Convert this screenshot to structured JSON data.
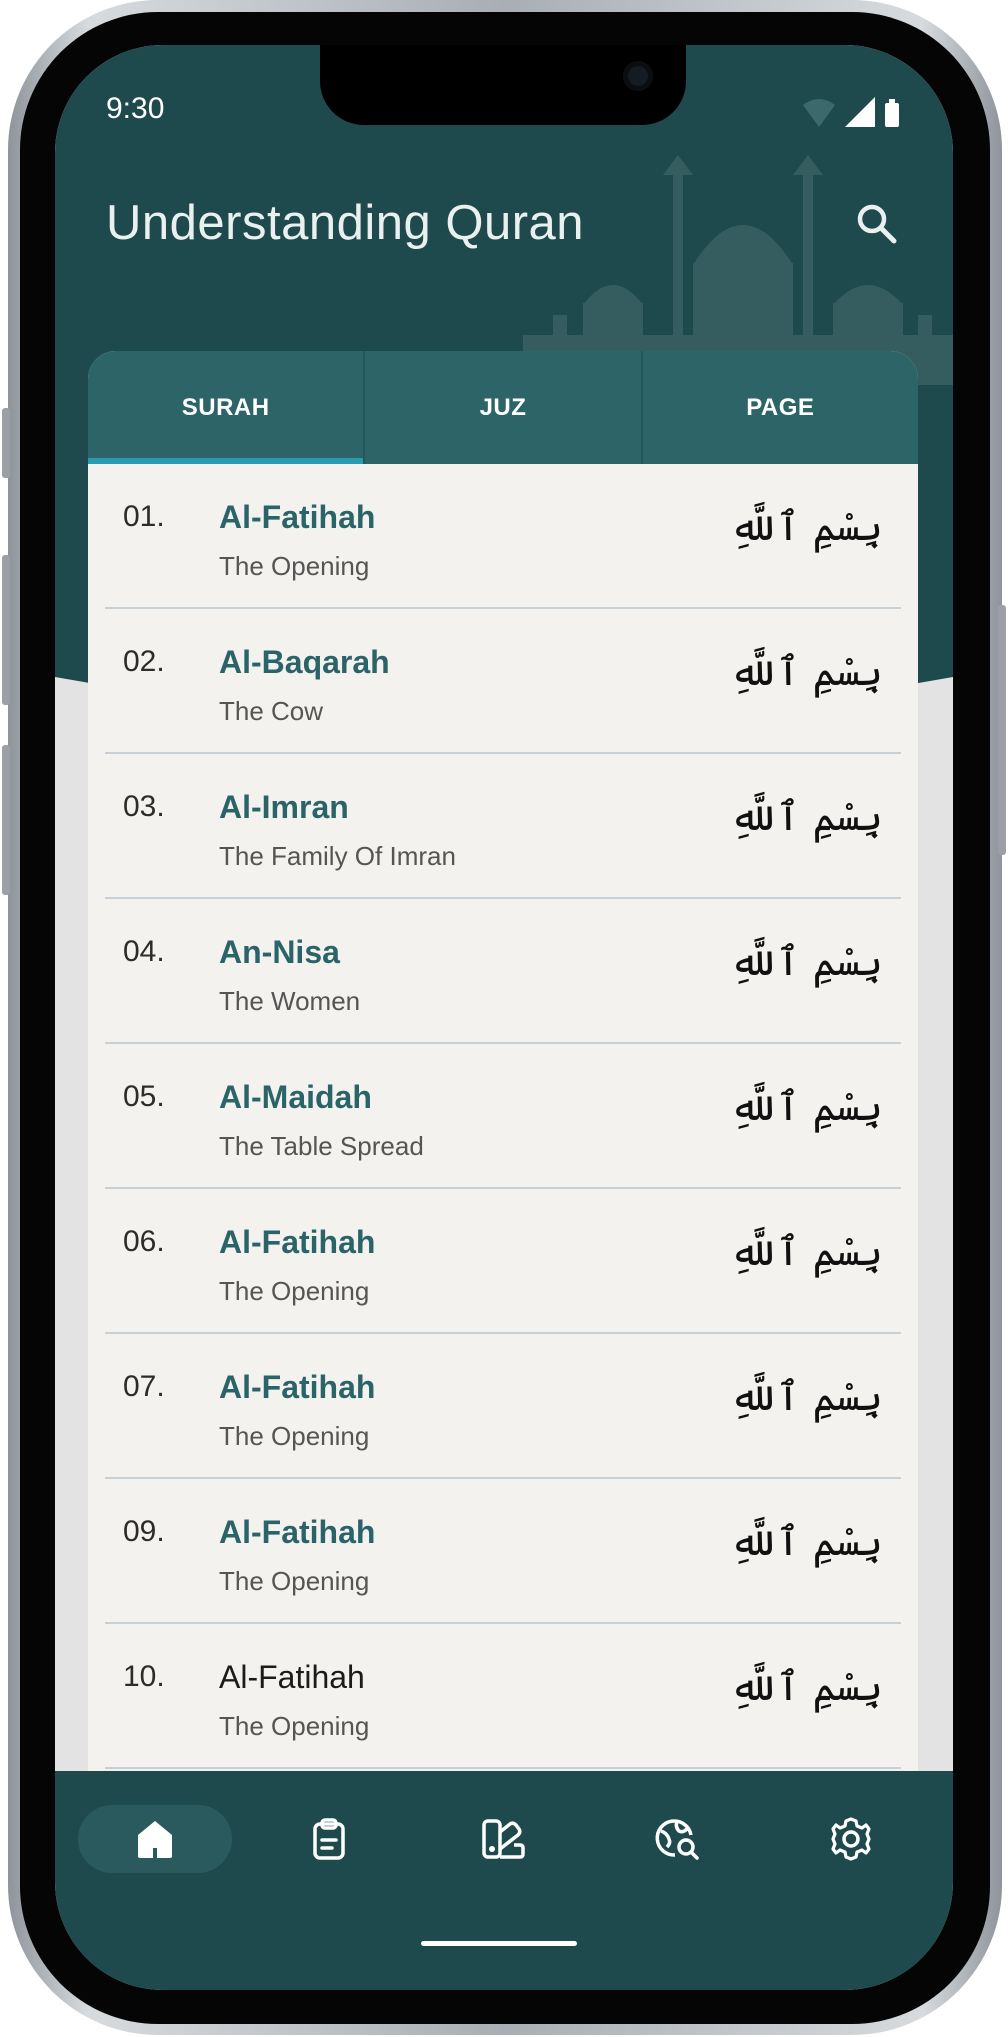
{
  "status_bar": {
    "time": "9:30"
  },
  "app": {
    "title": "Understanding Quran"
  },
  "tabs": [
    {
      "label": "SURAH",
      "active": true
    },
    {
      "label": "JUZ",
      "active": false
    },
    {
      "label": "PAGE",
      "active": false
    }
  ],
  "surahs": [
    {
      "number": "01.",
      "name": "Al-Fatihah",
      "meaning": "The Opening",
      "arabic": "بِسْمِ ٱللَّهِ"
    },
    {
      "number": "02.",
      "name": "Al-Baqarah",
      "meaning": "The Cow",
      "arabic": "بِسْمِ ٱللَّهِ"
    },
    {
      "number": "03.",
      "name": "Al-Imran",
      "meaning": "The Family Of Imran",
      "arabic": "بِسْمِ ٱللَّهِ"
    },
    {
      "number": "04.",
      "name": "An-Nisa",
      "meaning": "The Women",
      "arabic": "بِسْمِ ٱللَّهِ"
    },
    {
      "number": "05.",
      "name": "Al-Maidah",
      "meaning": "The Table Spread",
      "arabic": "بِسْمِ ٱللَّهِ"
    },
    {
      "number": "06.",
      "name": "Al-Fatihah",
      "meaning": "The Opening",
      "arabic": "بِسْمِ ٱللَّهِ"
    },
    {
      "number": "07.",
      "name": "Al-Fatihah",
      "meaning": "The Opening",
      "arabic": "بِسْمِ ٱللَّهِ"
    },
    {
      "number": "09.",
      "name": "Al-Fatihah",
      "meaning": "The Opening",
      "arabic": "بِسْمِ ٱللَّهِ"
    },
    {
      "number": "10.",
      "name": "Al-Fatihah",
      "meaning": "The Opening",
      "arabic": "بِسْمِ ٱللَّهِ"
    }
  ],
  "nav": [
    {
      "icon": "home-icon",
      "active": true
    },
    {
      "icon": "clipboard-icon",
      "active": false
    },
    {
      "icon": "swatch-book-icon",
      "active": false
    },
    {
      "icon": "globe-search-icon",
      "active": false
    },
    {
      "icon": "settings-gear-icon",
      "active": false
    }
  ],
  "colors": {
    "primary": "#1f4a4d",
    "tab_bar": "#2c6468",
    "tab_indicator": "#2a9bb0",
    "surah_name": "#2b6468",
    "card_background": "#f3f2ee"
  }
}
